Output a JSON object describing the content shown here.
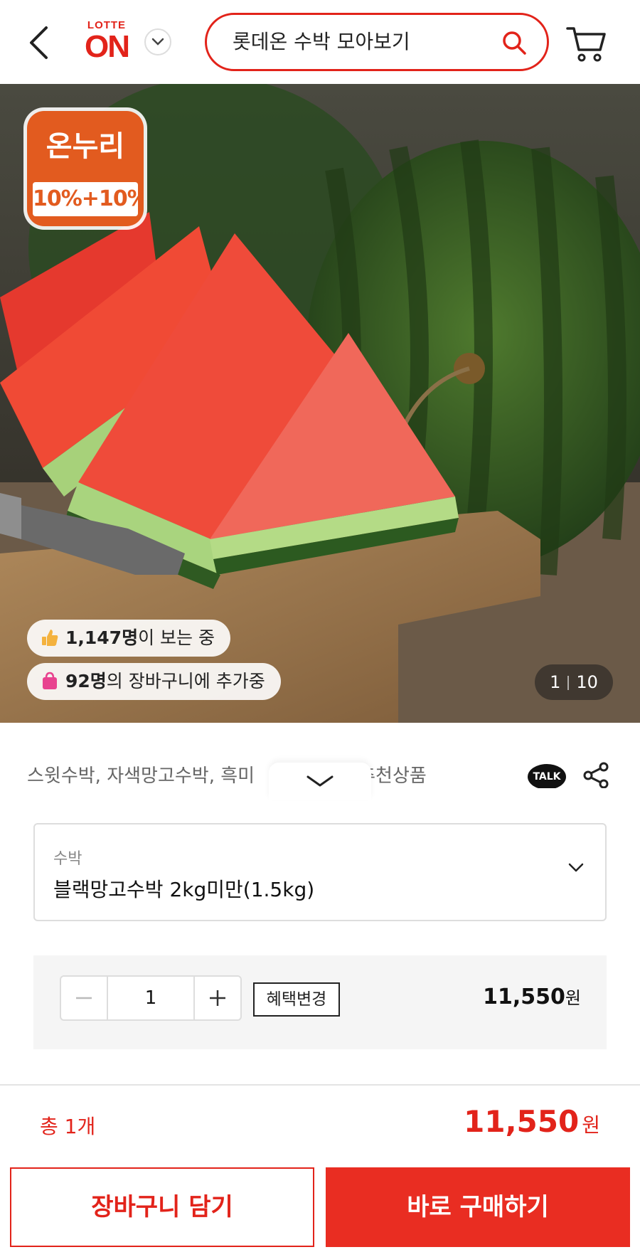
{
  "header": {
    "logo_top": "LOTTE",
    "logo_main": "ON",
    "search_value": "롯데온 수박 모아보기"
  },
  "hero": {
    "badge_brand": "온누리",
    "badge_discount": "10%+10%",
    "viewers_count": "1,147명",
    "viewers_suffix": "이 보는 중",
    "cart_count": "92명",
    "cart_suffix": "의 장바구니에 추가중",
    "counter_current": "1",
    "counter_total": "10"
  },
  "product": {
    "related_text": "스윗수박, 자색망고수박, 흑미",
    "related_text_tail": "추천상품",
    "talk_label": "TALK"
  },
  "option": {
    "label": "수박",
    "value": "블랙망고수박 2kg미만(1.5kg)"
  },
  "quantity": {
    "value": "1",
    "benefit_label": "혜택변경",
    "price": "11,550",
    "price_unit": "원"
  },
  "total": {
    "label": "총 1개",
    "price": "11,550",
    "unit": "원"
  },
  "actions": {
    "cart_label": "장바구니 담기",
    "buy_label": "바로 구매하기"
  },
  "colors": {
    "brand_red": "#e2231a",
    "onnuri_orange": "#e25b1f"
  }
}
